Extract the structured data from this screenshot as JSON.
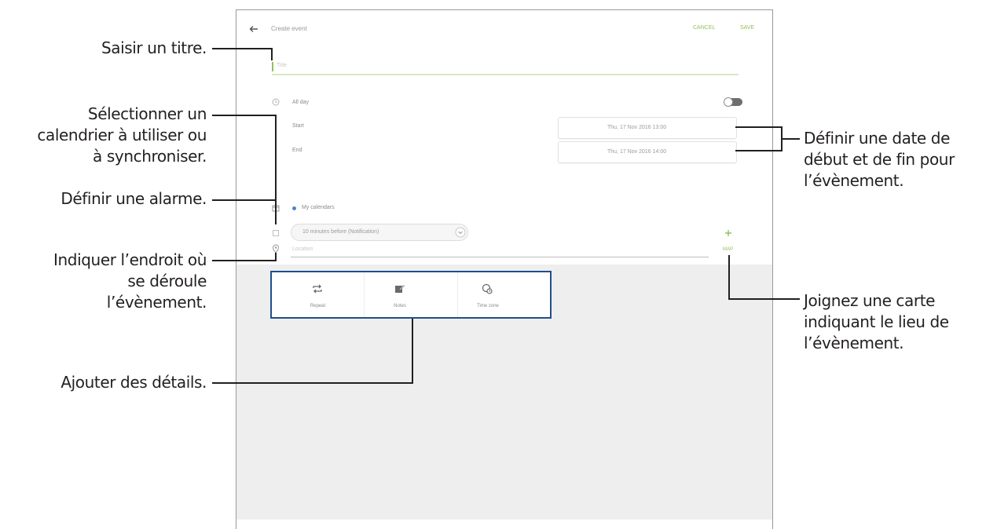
{
  "app": {
    "header_title": "Create event",
    "cancel_label": "CANCEL",
    "save_label": "SAVE",
    "title_placeholder": "Title",
    "allday_label": "All day",
    "start_label": "Start",
    "end_label": "End",
    "start_value": "Thu, 17 Nov 2016  13:00",
    "end_value": "Thu, 17 Nov 2016  14:00",
    "calendar_label": "My calendars",
    "reminder_value": "10 minutes before (Notification)",
    "location_placeholder": "Location",
    "map_label": "MAP",
    "details": [
      {
        "label": "Repeat",
        "icon": "repeat-icon"
      },
      {
        "label": "Notes",
        "icon": "notes-icon"
      },
      {
        "label": "Time zone",
        "icon": "time-zone-icon"
      }
    ]
  },
  "annotations": {
    "title": "Saisir un titre.",
    "calendar": [
      "Sélectionner un",
      "calendrier à utiliser ou",
      "à synchroniser."
    ],
    "alarm": "Définir une alarme.",
    "location": [
      "Indiquer l’endroit où",
      "se déroule",
      "l’évènement."
    ],
    "details": "Ajouter des détails.",
    "dates": [
      "Définir une date de",
      "début et de fin pour",
      "l’évènement."
    ],
    "map": [
      "Joignez une carte",
      "indiquant le lieu de",
      "l’évènement."
    ]
  },
  "colors": {
    "accent": "#8fc25a",
    "calendar_dot": "#4a86c8",
    "callout_border": "#1f4e8c",
    "annotation_text": "#231f20"
  }
}
